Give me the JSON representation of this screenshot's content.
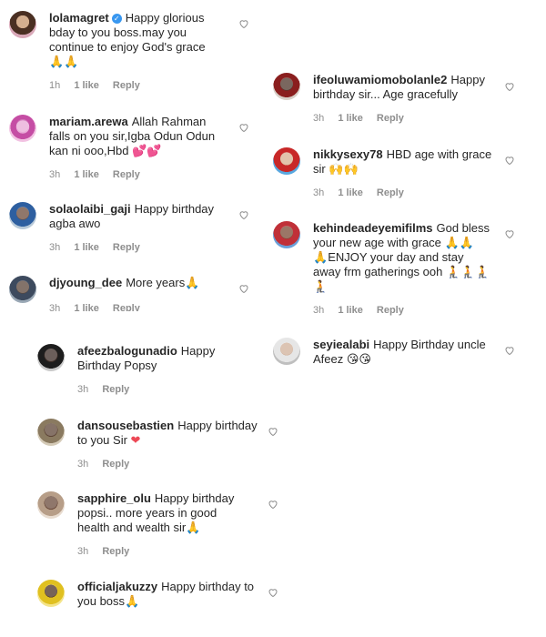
{
  "comments": {
    "c1": {
      "user": "lolamagret",
      "line1": "Happy glorious",
      "line2": "bday to you boss.may you",
      "line3": "continue to enjoy God's grace",
      "emoji": "🙏🙏",
      "time": "1h",
      "likes": "1 like",
      "reply": "Reply"
    },
    "c2": {
      "user": "mariam.arewa",
      "line1": "Allah Rahman",
      "line2": "falls on you sir,Igba Odun Odun",
      "line3": "kan ni ooo,Hbd",
      "time": "3h",
      "likes": "1 like",
      "reply": "Reply"
    },
    "c3": {
      "user": "solaolaibi_gaji",
      "line1": "Happy birthday",
      "line2": "agba awo",
      "time": "3h",
      "likes": "1 like",
      "reply": "Reply"
    },
    "c4": {
      "user": "djyoung_dee",
      "line1": "More years",
      "time": "3h",
      "likes": "1 like",
      "reply": "Reply"
    },
    "c5": {
      "user": "afeezbalogunadio",
      "line1": "Happy",
      "line2": "Birthday Popsy",
      "time": "3h",
      "reply": "Reply"
    },
    "c6": {
      "user": "dansousebastien",
      "line1": "Happy birthday",
      "line2": "to you Sir",
      "time": "3h",
      "reply": "Reply"
    },
    "c7": {
      "user": "sapphire_olu",
      "line1": "Happy birthday",
      "line2": "popsi.. more years in good",
      "line3": "health and wealth sir",
      "time": "3h",
      "reply": "Reply"
    },
    "c8": {
      "user": "officialjakuzzy",
      "line1": "Happy birthday to",
      "line2": "you boss"
    },
    "r1": {
      "user": "ifeoluwamiomobolanle2",
      "line1": "Happy",
      "line2": "birthday sir... Age gracefully",
      "time": "3h",
      "likes": "1 like",
      "reply": "Reply"
    },
    "r2": {
      "user": "nikkysexy78",
      "line1": "HBD age with grace",
      "line2": "sir",
      "time": "3h",
      "likes": "1 like",
      "reply": "Reply"
    },
    "r3": {
      "user": "kehindeadeyemifilms",
      "line1": "God bless",
      "line2": "your new age with grace",
      "line3": "ENJOY your day and stay",
      "line4": "away frm gatherings ooh",
      "time": "3h",
      "likes": "1 like",
      "reply": "Reply"
    },
    "r4": {
      "user": "seyiealabi",
      "line1": "Happy Birthday uncle",
      "line2": "Afeez"
    }
  },
  "icons": {
    "heart": "heart-outline-icon",
    "verified": "verified-badge-icon"
  },
  "colors": {
    "text": "#262626",
    "meta": "#8e8e8e",
    "verified": "#3897f0"
  }
}
